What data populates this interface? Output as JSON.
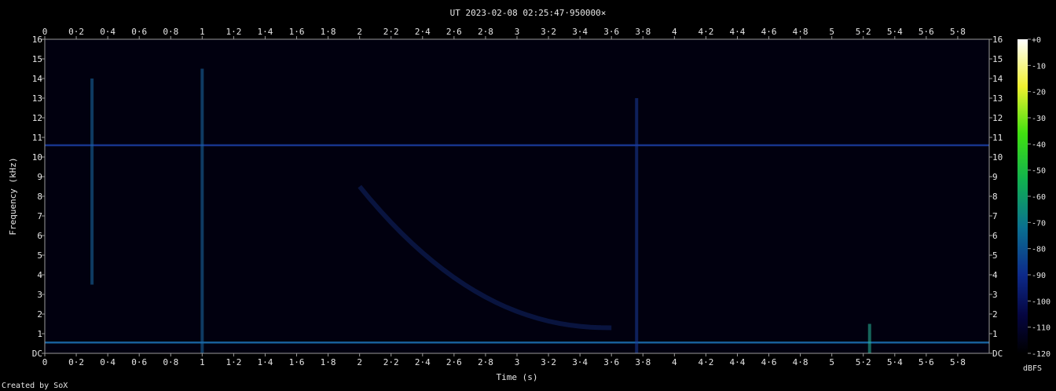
{
  "chart_data": {
    "type": "heatmap",
    "title": "UT 2023-02-08 02:25:47·950000×",
    "xlabel": "Time (s)",
    "ylabel": "Frequency (kHz)",
    "credit": "Created by SoX",
    "xlim": [
      0,
      6
    ],
    "ylim": [
      0,
      16
    ],
    "x_ticks": [
      "0",
      "0·2",
      "0·4",
      "0·6",
      "0·8",
      "1",
      "1·2",
      "1·4",
      "1·6",
      "1·8",
      "2",
      "2·2",
      "2·4",
      "2·6",
      "2·8",
      "3",
      "3·2",
      "3·4",
      "3·6",
      "3·8",
      "4",
      "4·2",
      "4·4",
      "4·6",
      "4·8",
      "5",
      "5·2",
      "5·4",
      "5·6",
      "5·8"
    ],
    "y_ticks": [
      "DC",
      "1",
      "2",
      "3",
      "4",
      "5",
      "6",
      "7",
      "8",
      "9",
      "10",
      "11",
      "12",
      "13",
      "14",
      "15",
      "16"
    ],
    "colorbar": {
      "label": "dBFS",
      "range": [
        -120,
        0
      ],
      "ticks": [
        "+0",
        "-10",
        "-20",
        "-30",
        "-40",
        "-50",
        "-60",
        "-70",
        "-80",
        "-90",
        "-100",
        "-110",
        "-120"
      ]
    },
    "features": [
      {
        "kind": "tone",
        "freq_khz": 10.6,
        "t_start": 0,
        "t_end": 6,
        "level_dbfs": -85
      },
      {
        "kind": "tone",
        "freq_khz": 0.55,
        "t_start": 0,
        "t_end": 6,
        "level_dbfs": -75
      },
      {
        "kind": "burst",
        "t": 0.3,
        "f_low": 3.5,
        "f_high": 14,
        "level_dbfs": -75
      },
      {
        "kind": "burst",
        "t": 1.0,
        "f_low": 0,
        "f_high": 14.5,
        "level_dbfs": -70
      },
      {
        "kind": "burst",
        "t": 3.76,
        "f_low": 0,
        "f_high": 13,
        "level_dbfs": -90
      },
      {
        "kind": "burst",
        "t": 5.24,
        "f_low": 0,
        "f_high": 1.5,
        "level_dbfs": -65
      },
      {
        "kind": "whistler",
        "t_start": 2.0,
        "t_end": 3.6,
        "f_start": 8.5,
        "f_end": 1.3,
        "level_dbfs": -85
      }
    ]
  }
}
